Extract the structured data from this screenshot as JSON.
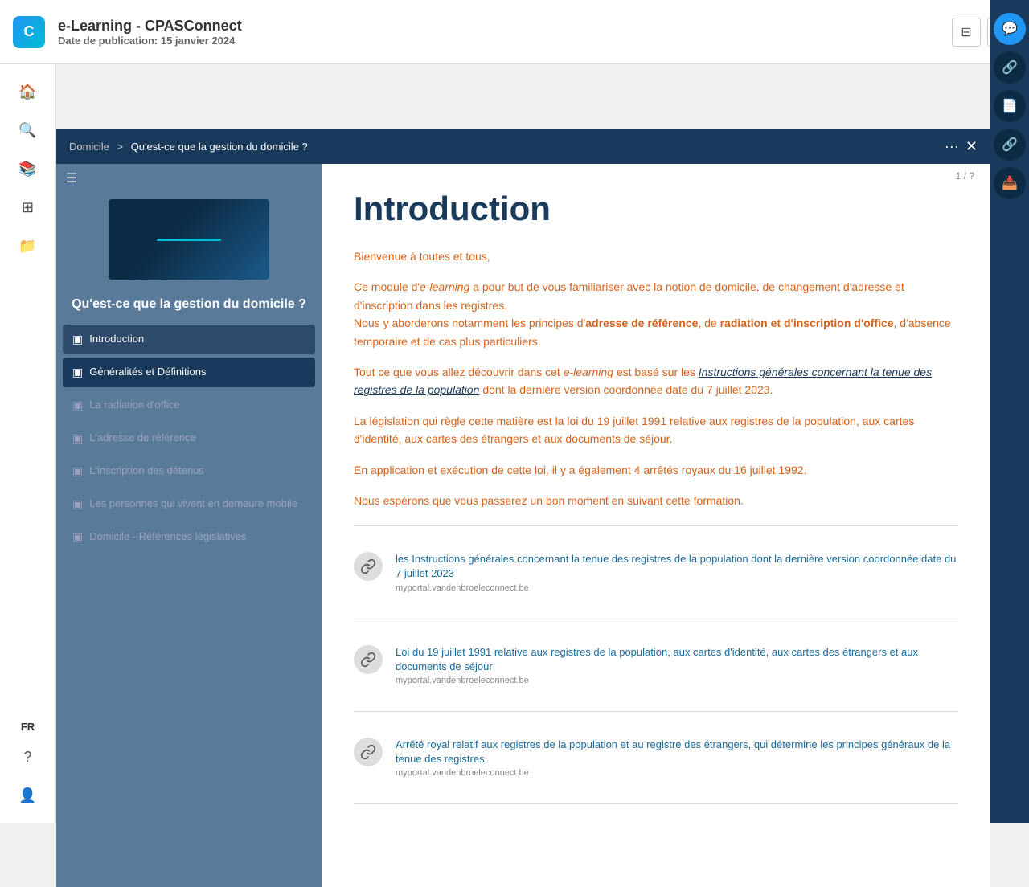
{
  "topbar": {
    "logo_text": "C",
    "title": "e-Learning - CPASConnect",
    "date_label": "Date de publication:",
    "date_value": "15 janvier 2024",
    "btn_bookmark": "⊟",
    "btn_star": "☆"
  },
  "breadcrumb": {
    "home": "Domicile",
    "separator": ">",
    "current": "Qu'est-ce que la gestion du domicile ?"
  },
  "modal_header": {
    "dots": "···",
    "close": "✕"
  },
  "page_counter": "1 / ?",
  "panel": {
    "toggle_icon": "☰",
    "title": "Qu'est-ce que la gestion du domicile ?",
    "nav_items": [
      {
        "label": "Introduction",
        "active": true,
        "disabled": false
      },
      {
        "label": "Généralités et Définitions",
        "active": true,
        "disabled": false
      },
      {
        "label": "La radiation d'office",
        "active": false,
        "disabled": true
      },
      {
        "label": "L'adresse de référence",
        "active": false,
        "disabled": true
      },
      {
        "label": "L'inscription des détenus",
        "active": false,
        "disabled": true
      },
      {
        "label": "Les personnes qui vivent en demeure mobile",
        "active": false,
        "disabled": true
      },
      {
        "label": "Domicile - Références législatives",
        "active": false,
        "disabled": true
      }
    ]
  },
  "content": {
    "title": "Introduction",
    "paragraphs": [
      {
        "id": "p1",
        "text": "Bienvenue à toutes et tous,",
        "orange": true
      },
      {
        "id": "p2",
        "text": "Ce module d'e-learning a pour but de vous familiariser avec la notion de domicile, de changement d'adresse et d'inscription dans les registres.\nNous y aborderons notamment les principes d'adresse de référence, de radiation et d'inscription d'office, d'absence temporaire et de cas plus particuliers.",
        "orange": true
      },
      {
        "id": "p3",
        "text": "Tout ce que vous allez découvrir dans cet e-learning est basé sur les Instructions générales concernant la tenue des registres de la population dont la dernière version coordonnée date du 7 juillet 2023.",
        "orange": true
      },
      {
        "id": "p4",
        "text": "La législation qui règle cette matière est la loi du 19 juillet 1991 relative aux registres de la population, aux cartes d'identité, aux cartes des étrangers et aux documents de séjour.",
        "orange": true
      },
      {
        "id": "p5",
        "text": "En application et exécution de cette loi, il y a également 4 arrêtés royaux du 16 juillet 1992.",
        "orange": true
      },
      {
        "id": "p6",
        "text": "Nous espérons que vous passerez un bon moment en suivant cette formation.",
        "orange": true
      }
    ],
    "links": [
      {
        "id": "link1",
        "title": "les Instructions générales concernant la tenue des registres de la population dont la dernière version coordonnée date du 7 juillet 2023",
        "url": "myportal.vandenbroeleconnect.be"
      },
      {
        "id": "link2",
        "title": "Loi du 19 juillet 1991 relative aux registres de la population, aux cartes d'identité, aux cartes des étrangers et aux documents de séjour",
        "url": "myportal.vandenbroeleconnect.be"
      },
      {
        "id": "link3",
        "title": "Arrêté royal relatif aux registres de la population et au registre des étrangers, qui détermine les principes généraux de la tenue des registres",
        "url": "myportal.vandenbroeleconnect.be"
      }
    ]
  },
  "right_sidebar": {
    "icons": [
      "💬",
      "🔗",
      "📄",
      "🔗",
      "📥"
    ]
  },
  "left_sidebar": {
    "icons": [
      "🏠",
      "🔍",
      "📚",
      "⊞",
      "📁"
    ],
    "bottom": [
      "FR",
      "?",
      "👤"
    ]
  }
}
